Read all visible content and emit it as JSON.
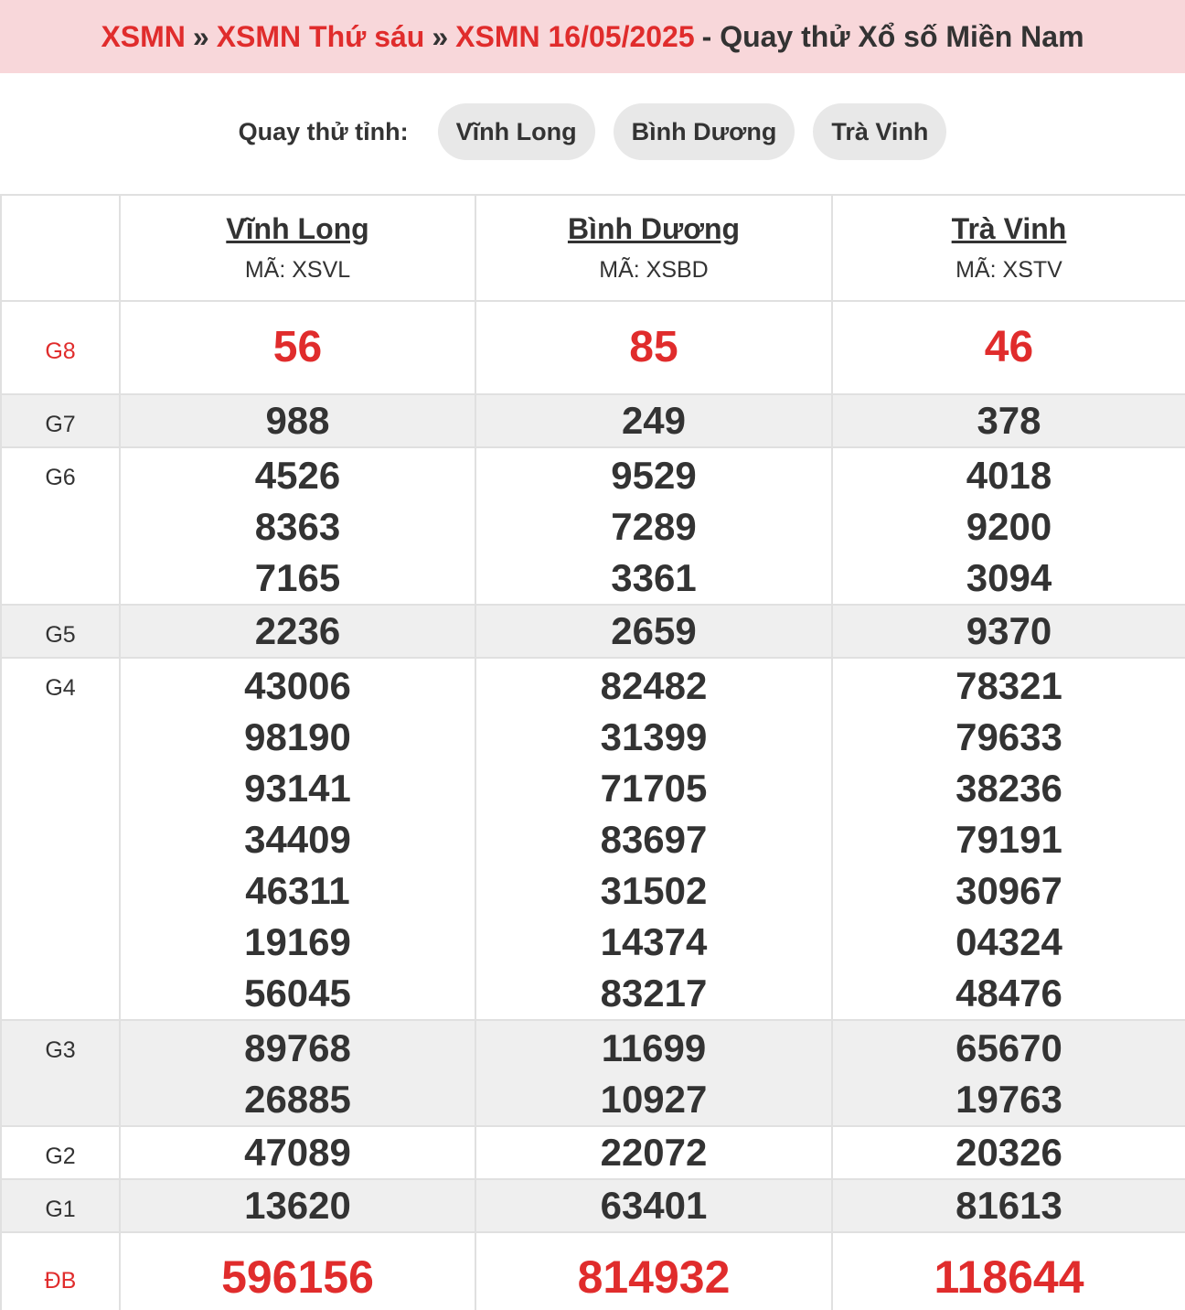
{
  "title": {
    "crumb1": "XSMN",
    "crumb2": "XSMN Thứ sáu",
    "crumb3": "XSMN 16/05/2025",
    "sep": "»",
    "rest": "- Quay thử Xổ số Miền Nam"
  },
  "province_bar": {
    "label": "Quay thử tỉnh:",
    "provinces": [
      "Vĩnh Long",
      "Bình Dương",
      "Trà Vinh"
    ]
  },
  "table": {
    "columns": [
      {
        "name": "Vĩnh Long",
        "code": "MÃ: XSVL"
      },
      {
        "name": "Bình Dương",
        "code": "MÃ: XSBD"
      },
      {
        "name": "Trà Vinh",
        "code": "MÃ: XSTV"
      }
    ],
    "prizes": {
      "g8": {
        "label": "G8",
        "values": [
          [
            "56"
          ],
          [
            "85"
          ],
          [
            "46"
          ]
        ]
      },
      "g7": {
        "label": "G7",
        "values": [
          [
            "988"
          ],
          [
            "249"
          ],
          [
            "378"
          ]
        ]
      },
      "g6": {
        "label": "G6",
        "values": [
          [
            "4526",
            "8363",
            "7165"
          ],
          [
            "9529",
            "7289",
            "3361"
          ],
          [
            "4018",
            "9200",
            "3094"
          ]
        ]
      },
      "g5": {
        "label": "G5",
        "values": [
          [
            "2236"
          ],
          [
            "2659"
          ],
          [
            "9370"
          ]
        ]
      },
      "g4": {
        "label": "G4",
        "values": [
          [
            "43006",
            "98190",
            "93141",
            "34409",
            "46311",
            "19169",
            "56045"
          ],
          [
            "82482",
            "31399",
            "71705",
            "83697",
            "31502",
            "14374",
            "83217"
          ],
          [
            "78321",
            "79633",
            "38236",
            "79191",
            "30967",
            "04324",
            "48476"
          ]
        ]
      },
      "g3": {
        "label": "G3",
        "values": [
          [
            "89768",
            "26885"
          ],
          [
            "11699",
            "10927"
          ],
          [
            "65670",
            "19763"
          ]
        ]
      },
      "g2": {
        "label": "G2",
        "values": [
          [
            "47089"
          ],
          [
            "22072"
          ],
          [
            "20326"
          ]
        ]
      },
      "g1": {
        "label": "G1",
        "values": [
          [
            "13620"
          ],
          [
            "63401"
          ],
          [
            "81613"
          ]
        ]
      },
      "db": {
        "label": "ĐB",
        "values": [
          [
            "596156"
          ],
          [
            "814932"
          ],
          [
            "118644"
          ]
        ]
      }
    }
  },
  "colors": {
    "accent_red": "#e02c2c",
    "title_bg": "#f8d7da",
    "alt_row_bg": "#efefef",
    "pill_bg": "#e8e8e8"
  }
}
